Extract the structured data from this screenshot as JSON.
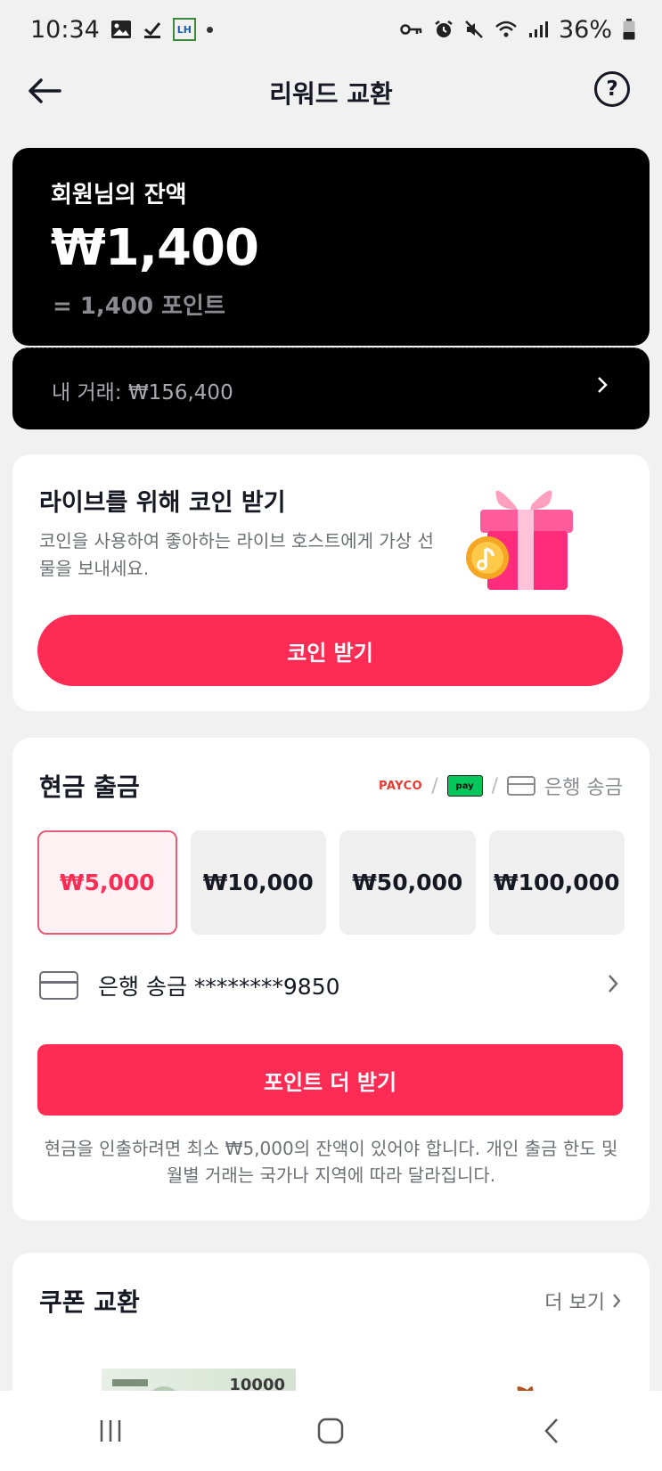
{
  "status_bar": {
    "time": "10:34",
    "lh_badge": "LH",
    "battery": "36%"
  },
  "header": {
    "title": "리워드 교환"
  },
  "balance": {
    "label": "회원님의 잔액",
    "amount": "₩1,400",
    "points": "= 1,400 포인트"
  },
  "transactions": {
    "label": "내 거래: ₩156,400"
  },
  "coin_section": {
    "title": "라이브를 위해 코인 받기",
    "description": "코인을 사용하여 좋아하는 라이브 호스트에게 가상 선물을 보내세요.",
    "button_label": "코인 받기"
  },
  "cash_section": {
    "title": "현금 출금",
    "payment_methods": {
      "payco": "PAYCO",
      "npay": "pay",
      "separator": "/",
      "bank": "은행 송금"
    },
    "amounts": [
      "₩5,000",
      "₩10,000",
      "₩50,000",
      "₩100,000"
    ],
    "selected_amount_index": 0,
    "bank_account": "은행 송금 ********9850",
    "button_label": "포인트 더 받기",
    "notice": "현금을 인출하려면 최소 ₩5,000의 잔액이 있어야 합니다. 개인 출금 한도 및 월별 거래는 국가나 지역에 따라 달라집니다."
  },
  "coupon_section": {
    "title": "쿠폰 교환",
    "more_label": "더 보기",
    "voucher_text": "10000"
  },
  "colors": {
    "accent": "#fe2c55",
    "background": "#f1f1f2",
    "balance_card": "#000000"
  }
}
